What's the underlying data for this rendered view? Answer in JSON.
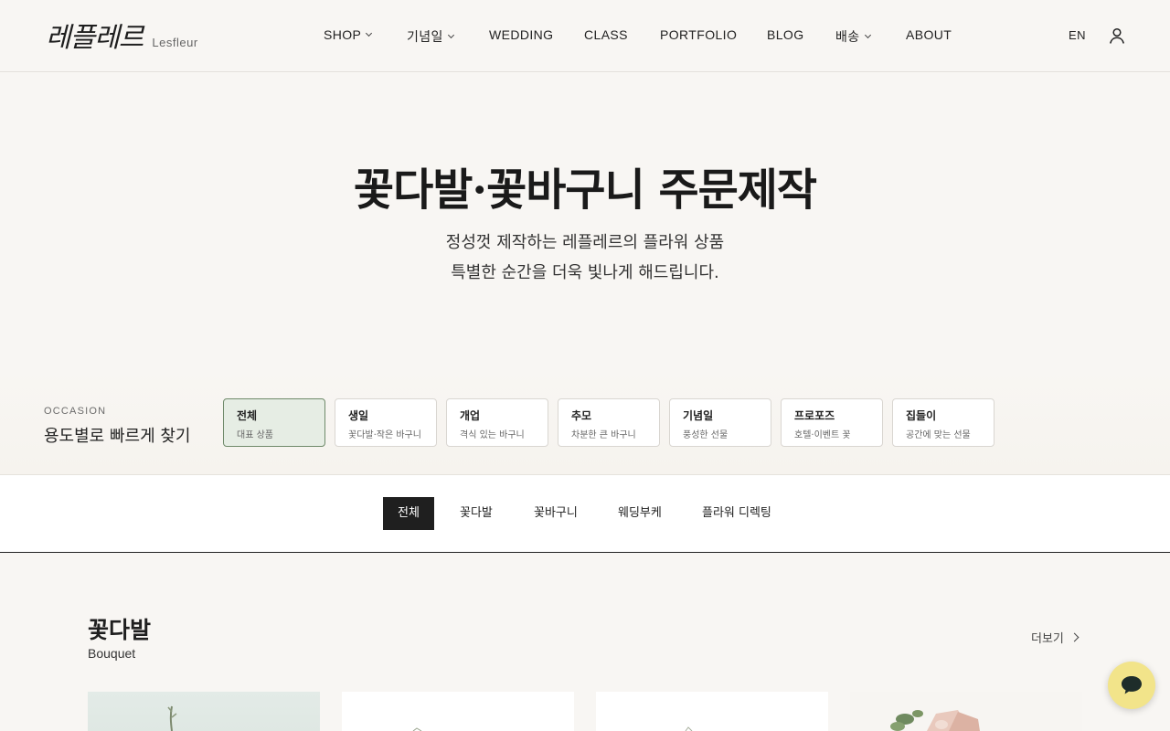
{
  "brand": {
    "name_ko": "레플레르",
    "name_en": "Lesfleur"
  },
  "nav": [
    {
      "label": "SHOP",
      "dropdown": true
    },
    {
      "label": "기념일",
      "dropdown": true
    },
    {
      "label": "WEDDING",
      "dropdown": false
    },
    {
      "label": "CLASS",
      "dropdown": false
    },
    {
      "label": "PORTFOLIO",
      "dropdown": false
    },
    {
      "label": "BLOG",
      "dropdown": false
    },
    {
      "label": "배송",
      "dropdown": true
    },
    {
      "label": "ABOUT",
      "dropdown": false
    }
  ],
  "header": {
    "lang": "EN"
  },
  "hero": {
    "title": "꽃다발·꽃바구니 주문제작",
    "subtitle_line1": "정성껏 제작하는 레플레르의 플라워 상품",
    "subtitle_line2": "특별한 순간을 더욱 빛나게 해드립니다."
  },
  "occasion": {
    "eyebrow": "OCCASION",
    "heading": "용도별로 빠르게 찾기",
    "cards": [
      {
        "title": "전체",
        "sub": "대표 상품",
        "active": true
      },
      {
        "title": "생일",
        "sub": "꽃다발·작은 바구니",
        "active": false
      },
      {
        "title": "개업",
        "sub": "격식 있는 바구니",
        "active": false
      },
      {
        "title": "추모",
        "sub": "차분한 큰 바구니",
        "active": false
      },
      {
        "title": "기념일",
        "sub": "풍성한 선물",
        "active": false
      },
      {
        "title": "프로포즈",
        "sub": "호텔·이벤트 꽃",
        "active": false
      },
      {
        "title": "집들이",
        "sub": "공간에 맞는 선물",
        "active": false
      }
    ]
  },
  "tabs": [
    {
      "label": "전체",
      "active": true
    },
    {
      "label": "꽃다발",
      "active": false
    },
    {
      "label": "꽃바구니",
      "active": false
    },
    {
      "label": "웨딩부케",
      "active": false
    },
    {
      "label": "플라워 디렉팅",
      "active": false
    }
  ],
  "section": {
    "title": "꽃다발",
    "subtitle": "Bouquet",
    "more_label": "더보기"
  },
  "colors": {
    "accent_dark": "#1f1f1f",
    "occasion_active_bg": "#e6ede4",
    "chat_bg": "#f2e48a"
  },
  "icons": {
    "user": "user-icon",
    "chat": "chat-bubble-icon",
    "more": "chevron-right-icon"
  }
}
